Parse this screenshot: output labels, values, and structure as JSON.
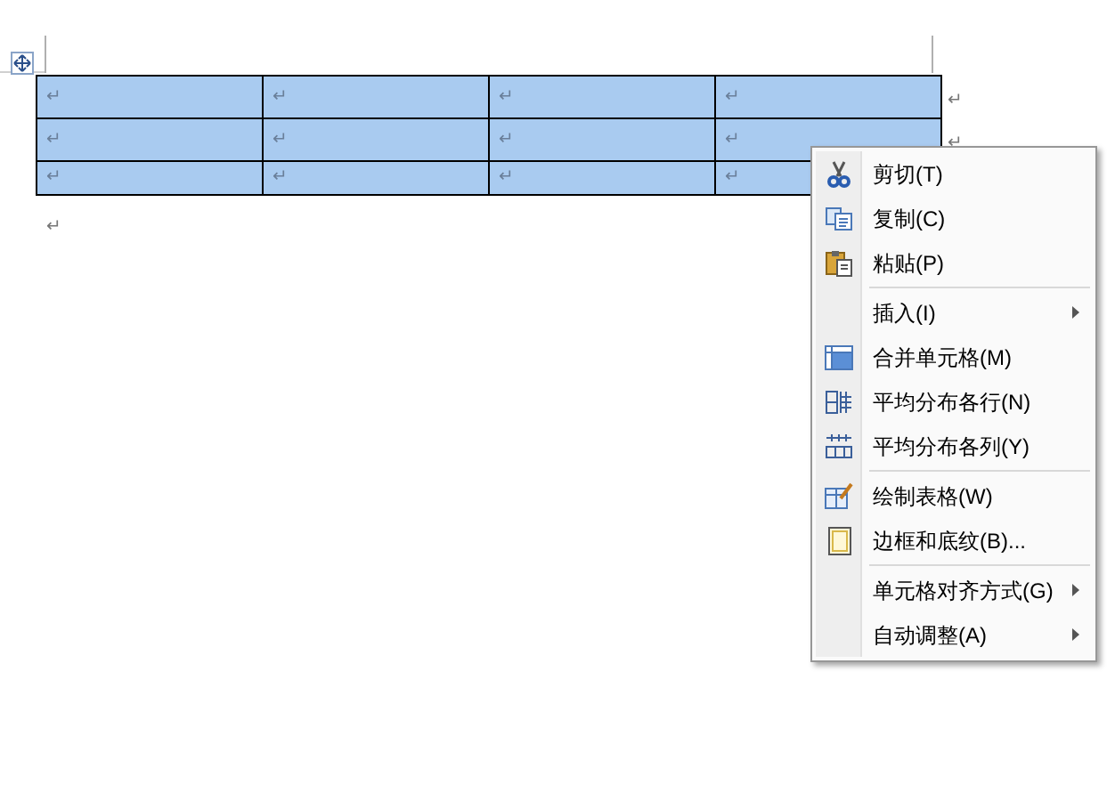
{
  "table": {
    "selected": true,
    "rows": [
      {
        "cells": [
          "↵",
          "↵",
          "↵",
          "↵"
        ],
        "end_mark": "↵"
      },
      {
        "cells": [
          "↵",
          "↵",
          "↵",
          "↵"
        ],
        "end_mark": "↵"
      },
      {
        "cells": [
          "↵",
          "↵",
          "↵",
          "↵"
        ]
      }
    ]
  },
  "paragraph_mark": "↵",
  "context_menu": {
    "groups": [
      [
        {
          "label": "剪切(T)",
          "submenu": false
        },
        {
          "label": "复制(C)",
          "submenu": false
        },
        {
          "label": "粘贴(P)",
          "submenu": false
        }
      ],
      [
        {
          "label": "插入(I)",
          "submenu": true
        },
        {
          "label": "合并单元格(M)",
          "submenu": false
        },
        {
          "label": "平均分布各行(N)",
          "submenu": false
        },
        {
          "label": "平均分布各列(Y)",
          "submenu": false
        }
      ],
      [
        {
          "label": "绘制表格(W)",
          "submenu": false
        },
        {
          "label": "边框和底纹(B)...",
          "submenu": false
        }
      ],
      [
        {
          "label": "单元格对齐方式(G)",
          "submenu": true
        },
        {
          "label": "自动调整(A)",
          "submenu": true
        }
      ]
    ]
  }
}
